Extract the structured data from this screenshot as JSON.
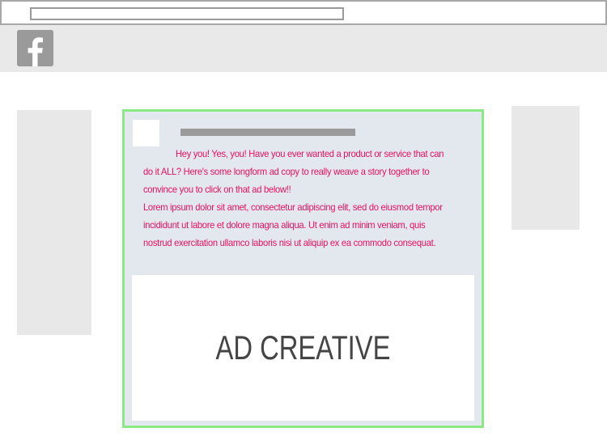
{
  "browser": {
    "address_value": ""
  },
  "header": {
    "logo_icon": "facebook-icon",
    "colors": {
      "logo_bg": "#9a9a9a",
      "header_bg": "#e9e9e9"
    }
  },
  "ad": {
    "copy_intro": "Hey you! Yes, you! Have you ever wanted a product or service that can do it ALL? Here's some longform ad copy to really weave a story together to convince you to click on that ad below!!",
    "copy_lorem": "Lorem ipsum dolor sit amet, consectetur adipiscing elit, sed do eiusmod tempor incididunt ut labore et dolore magna aliqua. Ut enim ad minim veniam, quis nostrud exercitation ullamco laboris nisi ut aliquip ex ea commodo consequat.",
    "creative_label": "AD CREATIVE",
    "colors": {
      "border": "#8be985",
      "copy_text": "#e8115d",
      "post_bg": "#e3e7ee"
    }
  }
}
